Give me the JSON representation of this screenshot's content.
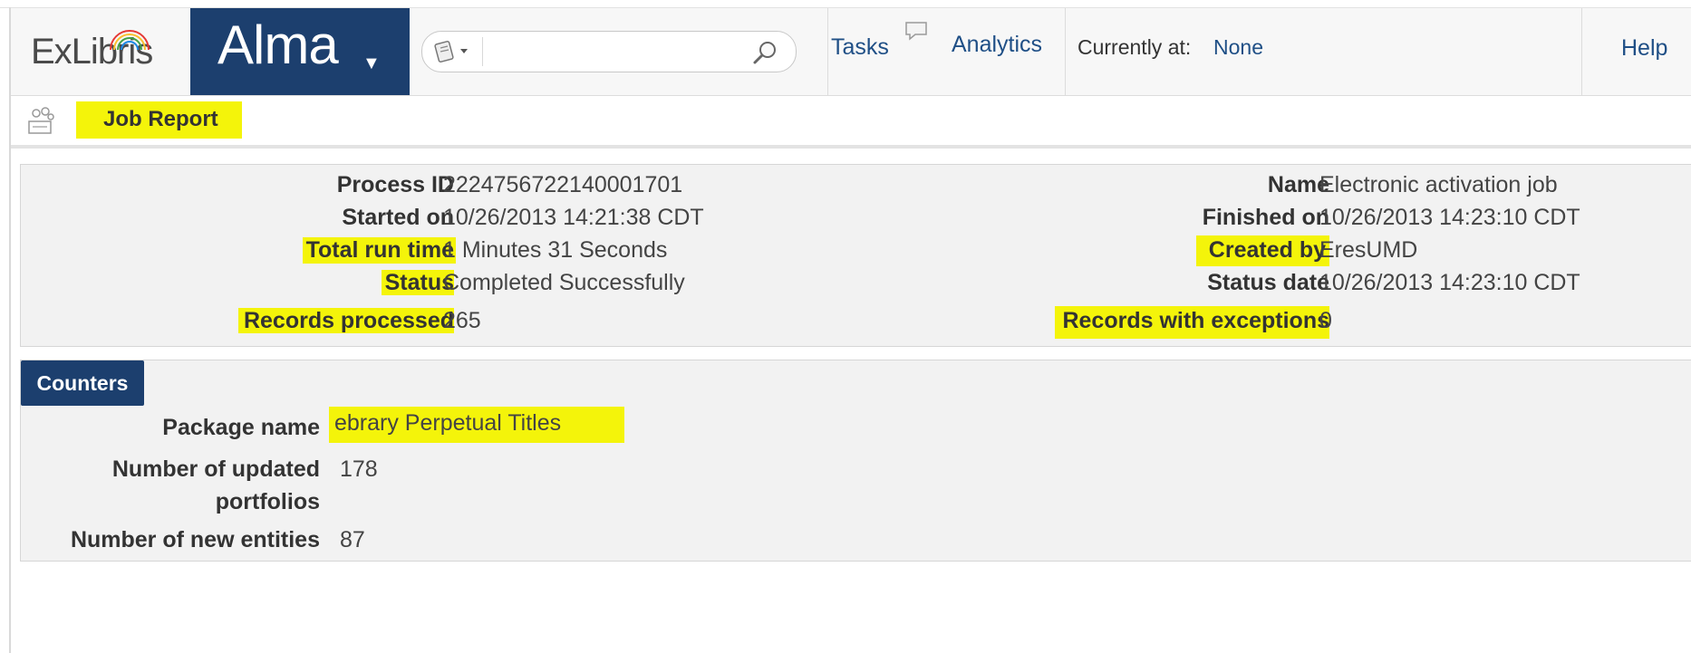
{
  "header": {
    "vendor_logo": "ExLibris",
    "app_name": "Alma",
    "search": {
      "value": "",
      "placeholder": ""
    },
    "nav": {
      "tasks": "Tasks",
      "analytics": "Analytics",
      "help": "Help"
    },
    "location": {
      "label": "Currently at:",
      "value": "None"
    }
  },
  "page": {
    "title": "Job Report"
  },
  "summary": {
    "left": [
      {
        "label": "Process ID",
        "value": "2224756722140001701"
      },
      {
        "label": "Started on",
        "value": "10/26/2013 14:21:38 CDT"
      },
      {
        "label": "Total run time",
        "value": "1 Minutes 31 Seconds"
      },
      {
        "label": "Status",
        "value": "Completed Successfully"
      },
      {
        "label": "Records processed",
        "value": "265"
      }
    ],
    "right": [
      {
        "label": "Name",
        "value": "Electronic activation job"
      },
      {
        "label": "Finished on",
        "value": "10/26/2013 14:23:10 CDT"
      },
      {
        "label": "Created by",
        "value": "EresUMD"
      },
      {
        "label": "Status date",
        "value": "10/26/2013 14:23:10 CDT"
      },
      {
        "label": "Records with exceptions",
        "value": "0"
      }
    ]
  },
  "counters": {
    "tab_label": "Counters",
    "items": [
      {
        "label_line1": "Package name",
        "label_line2": "",
        "value": "ebrary Perpetual Titles"
      },
      {
        "label_line1": "Number of updated",
        "label_line2": "portfolios",
        "value": "178"
      },
      {
        "label_line1": "Number of new entities",
        "label_line2": "",
        "value": "87"
      }
    ]
  },
  "colors": {
    "brand_navy": "#1c3f6e",
    "link_blue": "#1f4f86",
    "highlight_yellow": "#f4f40a",
    "panel_gray": "#f2f2f2"
  },
  "icons": [
    "search-scope-icon",
    "search-icon",
    "chat-bubble-icon",
    "job-report-icon",
    "logo-rainbow-icon",
    "dropdown-caret-icon"
  ]
}
